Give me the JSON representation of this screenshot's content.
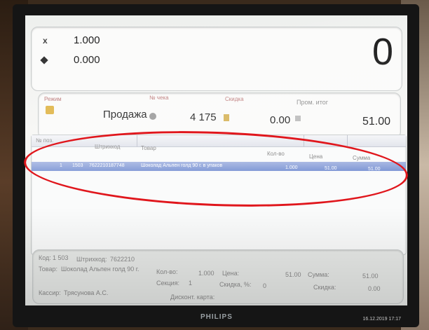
{
  "summary": {
    "x_label": "x",
    "quantity": "1.000",
    "amount": "0.000",
    "big_total": "0"
  },
  "mode_bar": {
    "mode_label": "Режим",
    "mode_value": "Продажа",
    "receipt_no_label": "№ чека",
    "receipt_no": "4 175",
    "discount_label": "Скидка",
    "discount_value": "0.00",
    "subtotal_label": "Пром. итог",
    "subtotal_value": "51.00"
  },
  "grid": {
    "columns": [
      "№ поз.",
      "Штрихкод",
      "Товар",
      "Кол-во",
      "Цена",
      "Сумма"
    ],
    "rows": [
      {
        "pos": "1",
        "code": "1503",
        "barcode": "7622210187748",
        "item": "Шоколад Альпен голд 90 г. в упаков",
        "qty": "1.000",
        "price": "51.00",
        "sum": "51.00"
      }
    ]
  },
  "details": {
    "code_label": "Код:",
    "code_value": "1 503",
    "barcode_label": "Штрихкод:",
    "barcode_value": "7622210",
    "item_label": "Товар:",
    "item_value": "Шоколад Альпен голд 90 г.",
    "qty_label": "Кол-во:",
    "qty_value": "1.000",
    "price_label": "Цена:",
    "price_value": "51.00",
    "sum_label": "Сумма:",
    "sum_value": "51.00",
    "section_label": "Секция:",
    "section_value": "1",
    "discount_pct_label": "Скидка, %:",
    "discount_pct_value": "0",
    "discount_label": "Скидка:",
    "discount_value": "0.00",
    "cashier_label": "Кассир:",
    "cashier_value": "Трясунова А.С.",
    "card_label": "Дисконт. карта:"
  },
  "footer": {
    "brand": "PHILIPS",
    "datetime": "16.12.2019 17:17"
  },
  "colors": {
    "highlight_row": "#8fa3dc",
    "annotation_ellipse": "#e0161c"
  }
}
